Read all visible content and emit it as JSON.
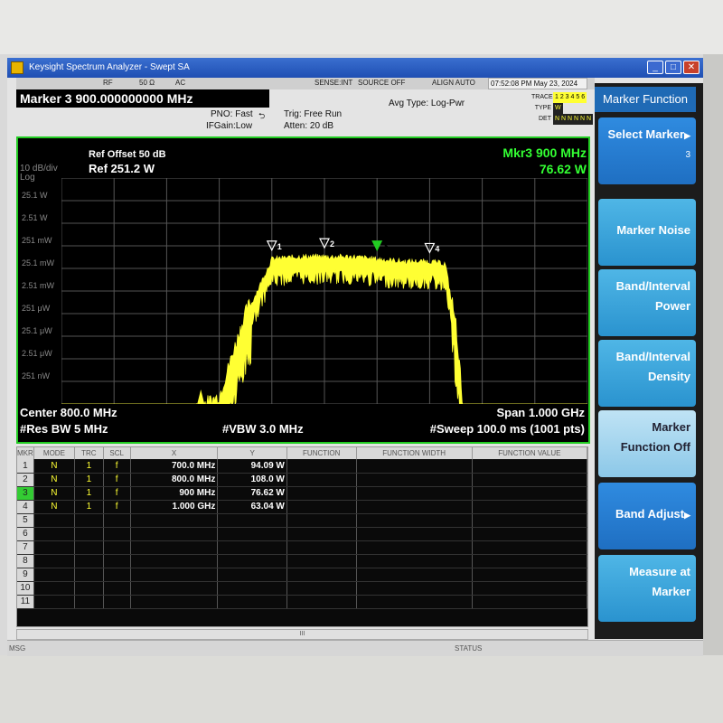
{
  "window": {
    "title": "Keysight Spectrum Analyzer - Swept SA"
  },
  "status_strip": {
    "rf": "RF",
    "impedance": "50 Ω",
    "coupling": "AC",
    "sense": "SENSE:INT",
    "source": "SOURCE OFF",
    "align": "ALIGN AUTO",
    "datetime": "07:52:08 PM May 23, 2024"
  },
  "marker_header": "Marker 3 900.000000000 MHz",
  "settings": {
    "pno": "PNO: Fast",
    "ifgain": "IFGain:Low",
    "trig": "Trig: Free Run",
    "atten": "Atten: 20 dB",
    "avg_type": "Avg Type: Log-Pwr"
  },
  "trace_info": {
    "trace_label": "TRACE",
    "trace_digits": "1 2 3 4 5 6",
    "type_label": "TYPE",
    "type_value": "W",
    "det_label": "DET",
    "det_value": "N N N N N N"
  },
  "graph": {
    "scale": "10 dB/div",
    "scale_type": "Log",
    "ref_offset": "Ref Offset 50 dB",
    "ref_level": "Ref 251.2 W",
    "marker_readout_freq": "Mkr3 900 MHz",
    "marker_readout_value": "76.62 W",
    "y_ticks": [
      "25.1 W",
      "2.51 W",
      "251 mW",
      "25.1 mW",
      "2.51 mW",
      "251 μW",
      "25.1 μW",
      "2.51 μW",
      "251 nW"
    ],
    "center": "Center 800.0 MHz",
    "span": "Span 1.000 GHz",
    "res_bw": "#Res BW 5 MHz",
    "vbw": "#VBW 3.0 MHz",
    "sweep": "#Sweep  100.0 ms (1001 pts)",
    "marker_labels": [
      "1",
      "2",
      "3",
      "4"
    ],
    "active_marker": "3",
    "trace_color": "#ffff33",
    "grid_color": "#555555",
    "border_color": "#22cc22"
  },
  "chart_data": {
    "type": "line",
    "title": "",
    "xlabel": "",
    "ylabel": "",
    "x_unit": "MHz",
    "xlim": [
      300,
      1300
    ],
    "ylim_dBm": [
      -10,
      84
    ],
    "x": [
      300,
      400,
      490,
      500,
      510,
      530,
      560,
      600,
      650,
      700,
      750,
      800,
      850,
      900,
      950,
      1000,
      1030,
      1050,
      1060,
      1070,
      1100,
      1200,
      1300
    ],
    "y_dBm": [
      -33,
      -33,
      -32,
      -30,
      -26,
      -20,
      -14,
      -10,
      25,
      49,
      50,
      50,
      50,
      49,
      48,
      48,
      47,
      20,
      -5,
      -30,
      -33,
      -33,
      -33
    ],
    "markers": [
      {
        "label": "1",
        "x": "700.0 MHz",
        "y": "94.09 W"
      },
      {
        "label": "2",
        "x": "800.0 MHz",
        "y": "108.0 W"
      },
      {
        "label": "3",
        "x": "900 MHz",
        "y": "76.62 W"
      },
      {
        "label": "4",
        "x": "1.000 GHz",
        "y": "63.04 W"
      }
    ]
  },
  "marker_table": {
    "headers": [
      "MKR",
      "MODE",
      "TRC",
      "SCL",
      "X",
      "Y",
      "FUNCTION",
      "FUNCTION WIDTH",
      "FUNCTION VALUE"
    ],
    "rows": [
      {
        "mkr": "1",
        "mode": "N",
        "trc": "1",
        "scl": "f",
        "x": "700.0 MHz",
        "y": "94.09 W"
      },
      {
        "mkr": "2",
        "mode": "N",
        "trc": "1",
        "scl": "f",
        "x": "800.0 MHz",
        "y": "108.0 W"
      },
      {
        "mkr": "3",
        "mode": "N",
        "trc": "1",
        "scl": "f",
        "x": "900 MHz",
        "y": "76.62 W"
      },
      {
        "mkr": "4",
        "mode": "N",
        "trc": "1",
        "scl": "f",
        "x": "1.000 GHz",
        "y": "63.04 W"
      },
      {
        "mkr": "5"
      },
      {
        "mkr": "6"
      },
      {
        "mkr": "7"
      },
      {
        "mkr": "8"
      },
      {
        "mkr": "9"
      },
      {
        "mkr": "10"
      },
      {
        "mkr": "11"
      }
    ],
    "selected_row": "3",
    "scroll_label": "III"
  },
  "msgbar": {
    "msg": "MSG",
    "status": "STATUS"
  },
  "softkeys": {
    "title": "Marker Function",
    "select_marker": "Select Marker",
    "select_marker_value": "3",
    "marker_noise": "Marker Noise",
    "band_power_1": "Band/Interval",
    "band_power_2": "Power",
    "band_density_1": "Band/Interval",
    "band_density_2": "Density",
    "function_off_1": "Marker",
    "function_off_2": "Function Off",
    "band_adjust": "Band Adjust",
    "measure_at_1": "Measure at",
    "measure_at_2": "Marker"
  }
}
